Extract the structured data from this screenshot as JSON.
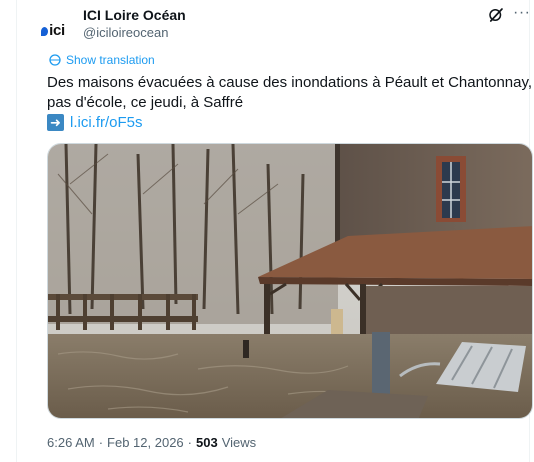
{
  "account": {
    "name": "ICI Loire Océan",
    "handle": "@iciloireocean",
    "avatar_text": "ici"
  },
  "translate": {
    "label": "Show translation"
  },
  "tweet": {
    "text": "Des maisons évacuées à cause des inondations à Péault et Chantonnay, pas d'école, ce jeudi, à Saffré",
    "link_text": "l.ici.fr/oF5s"
  },
  "media": {
    "description_icon": "photo",
    "accent_colors": {
      "water": "#7a6b58",
      "roof": "#8a5a40",
      "stone": "#6d5c4e"
    }
  },
  "meta": {
    "time": "6:26 AM",
    "separator": "·",
    "date": "Feb 12, 2026",
    "separator2": "·",
    "views_count": "503",
    "views_label": "Views"
  },
  "colors": {
    "link": "#1d9bf0",
    "secondary_text": "#536471",
    "primary_text": "#0f1419"
  }
}
